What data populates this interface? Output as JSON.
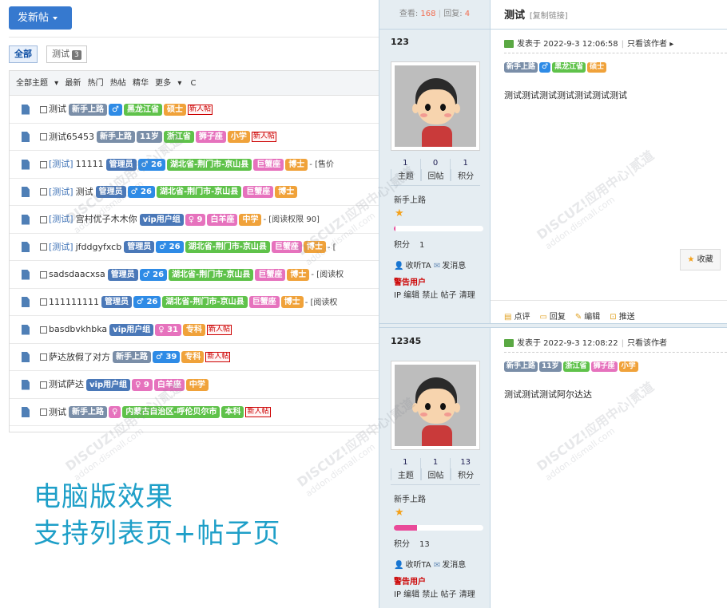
{
  "list_page": {
    "new_post_label": "发新帖",
    "filter_tabs": [
      {
        "label": "全部",
        "active": true
      },
      {
        "label": "测试",
        "count": "3"
      }
    ],
    "toolbar": [
      "全部主题",
      "最新",
      "热门",
      "热帖",
      "精华",
      "更多",
      "C"
    ],
    "rows": [
      {
        "category": "",
        "title": "测试",
        "tags": [
          {
            "text": "新手上路",
            "color": "grey"
          },
          {
            "text": "♂",
            "color": "blue"
          },
          {
            "text": "黑龙江省",
            "color": "green"
          },
          {
            "text": "硕士",
            "color": "orange"
          }
        ],
        "new": "新人帖",
        "tail": ""
      },
      {
        "category": "",
        "title": "测试65453",
        "tags": [
          {
            "text": "新手上路",
            "color": "grey"
          },
          {
            "text": "11岁",
            "color": "grey"
          },
          {
            "text": "浙江省",
            "color": "green"
          },
          {
            "text": "狮子座",
            "color": "pink"
          },
          {
            "text": "小学",
            "color": "orange"
          }
        ],
        "new": "新人帖",
        "tail": ""
      },
      {
        "category": "[测试]",
        "title": "11111",
        "tags": [
          {
            "text": "管理员",
            "color": "navy"
          },
          {
            "text": "♂ 26",
            "color": "blue"
          },
          {
            "text": "湖北省-荆门市-京山县",
            "color": "green"
          },
          {
            "text": "巨蟹座",
            "color": "pink"
          },
          {
            "text": "博士",
            "color": "orange"
          }
        ],
        "new": "",
        "tail": "- [售价"
      },
      {
        "category": "[测试]",
        "title": "测试",
        "tags": [
          {
            "text": "管理员",
            "color": "navy"
          },
          {
            "text": "♂ 26",
            "color": "blue"
          },
          {
            "text": "湖北省-荆门市-京山县",
            "color": "green"
          },
          {
            "text": "巨蟹座",
            "color": "pink"
          },
          {
            "text": "博士",
            "color": "orange"
          }
        ],
        "new": "",
        "tail": ""
      },
      {
        "category": "[测试]",
        "title": "宫村优子木木你",
        "tags": [
          {
            "text": "vip用户组",
            "color": "navy"
          },
          {
            "text": "♀ 9",
            "color": "pink"
          },
          {
            "text": "白羊座",
            "color": "pink"
          },
          {
            "text": "中学",
            "color": "orange"
          }
        ],
        "new": "",
        "tail": "- [阅读权限 90]"
      },
      {
        "category": "[测试]",
        "title": "jfddgyfxcb",
        "tags": [
          {
            "text": "管理员",
            "color": "navy"
          },
          {
            "text": "♂ 26",
            "color": "blue"
          },
          {
            "text": "湖北省-荆门市-京山县",
            "color": "green"
          },
          {
            "text": "巨蟹座",
            "color": "pink"
          },
          {
            "text": "博士",
            "color": "orange"
          }
        ],
        "new": "",
        "tail": "- ["
      },
      {
        "category": "",
        "title": "sadsdaacxsa",
        "tags": [
          {
            "text": "管理员",
            "color": "navy"
          },
          {
            "text": "♂ 26",
            "color": "blue"
          },
          {
            "text": "湖北省-荆门市-京山县",
            "color": "green"
          },
          {
            "text": "巨蟹座",
            "color": "pink"
          },
          {
            "text": "博士",
            "color": "orange"
          }
        ],
        "new": "",
        "tail": "- [阅读权"
      },
      {
        "category": "",
        "title": "111111111",
        "tags": [
          {
            "text": "管理员",
            "color": "navy"
          },
          {
            "text": "♂ 26",
            "color": "blue"
          },
          {
            "text": "湖北省-荆门市-京山县",
            "color": "green"
          },
          {
            "text": "巨蟹座",
            "color": "pink"
          },
          {
            "text": "博士",
            "color": "orange"
          }
        ],
        "new": "",
        "tail": "- [阅读权"
      },
      {
        "category": "",
        "title": "basdbvkhbka",
        "tags": [
          {
            "text": "vip用户组",
            "color": "navy"
          },
          {
            "text": "♀ 31",
            "color": "pink"
          },
          {
            "text": "专科",
            "color": "orange"
          }
        ],
        "new": "新人帖",
        "tail": ""
      },
      {
        "category": "",
        "title": "萨达放假了对方",
        "tags": [
          {
            "text": "新手上路",
            "color": "grey"
          },
          {
            "text": "♂ 39",
            "color": "blue"
          },
          {
            "text": "专科",
            "color": "orange"
          }
        ],
        "new": "新人帖",
        "tail": ""
      },
      {
        "category": "",
        "title": "测试萨达",
        "tags": [
          {
            "text": "vip用户组",
            "color": "navy"
          },
          {
            "text": "♀ 9",
            "color": "pink"
          },
          {
            "text": "白羊座",
            "color": "pink"
          },
          {
            "text": "中学",
            "color": "orange"
          }
        ],
        "new": "",
        "tail": ""
      },
      {
        "category": "",
        "title": "测试",
        "tags": [
          {
            "text": "新手上路",
            "color": "grey"
          },
          {
            "text": "♀",
            "color": "pink"
          },
          {
            "text": "内蒙古自治区-呼伦贝尔市",
            "color": "green"
          },
          {
            "text": "本科",
            "color": "green"
          }
        ],
        "new": "新人帖",
        "tail": ""
      }
    ],
    "promo_line1": "电脑版效果",
    "promo_line2": "支持列表页+帖子页"
  },
  "thread": {
    "views_label": "查看:",
    "views": "168",
    "replies_label": "回复:",
    "replies": "4",
    "title": "测试",
    "copy_link": "[复制链接]",
    "posts": [
      {
        "author": "123",
        "stats": [
          {
            "n": "1",
            "label": "主题"
          },
          {
            "n": "0",
            "label": "回帖"
          },
          {
            "n": "1",
            "label": "积分"
          }
        ],
        "group": "新手上路",
        "progress": 0.02,
        "points_label": "积分",
        "points": "1",
        "follow": "收听TA",
        "message": "发消息",
        "warning": "警告用户",
        "admin": "IP 编辑 禁止 帖子 清理",
        "posted": "发表于 2022-9-3 12:06:58",
        "only_author": "只看该作者",
        "tags": [
          {
            "text": "新手上路",
            "color": "grey"
          },
          {
            "text": "♂",
            "color": "blue"
          },
          {
            "text": "黑龙江省",
            "color": "green"
          },
          {
            "text": "硕士",
            "color": "orange"
          }
        ],
        "content": "测试测试测试测试测试测试测试",
        "favorite": "收藏",
        "actions": [
          "点评",
          "回复",
          "编辑",
          "推送"
        ]
      },
      {
        "author": "12345",
        "stats": [
          {
            "n": "1",
            "label": "主题"
          },
          {
            "n": "1",
            "label": "回帖"
          },
          {
            "n": "13",
            "label": "积分"
          }
        ],
        "group": "新手上路",
        "progress": 0.26,
        "points_label": "积分",
        "points": "13",
        "follow": "收听TA",
        "message": "发消息",
        "warning": "警告用户",
        "admin": "IP 编辑 禁止 帖子 清理",
        "posted": "发表于 2022-9-3 12:08:22",
        "only_author": "只看该作者",
        "tags": [
          {
            "text": "新手上路",
            "color": "grey"
          },
          {
            "text": "11岁",
            "color": "grey"
          },
          {
            "text": "浙江省",
            "color": "green"
          },
          {
            "text": "狮子座",
            "color": "pink"
          },
          {
            "text": "小学",
            "color": "orange"
          }
        ],
        "content": "测试测试测试阿尔达达"
      }
    ]
  },
  "watermark_text": "DISCUZ!应用中心|贰道",
  "watermark_sub": "addon.dismall.com"
}
